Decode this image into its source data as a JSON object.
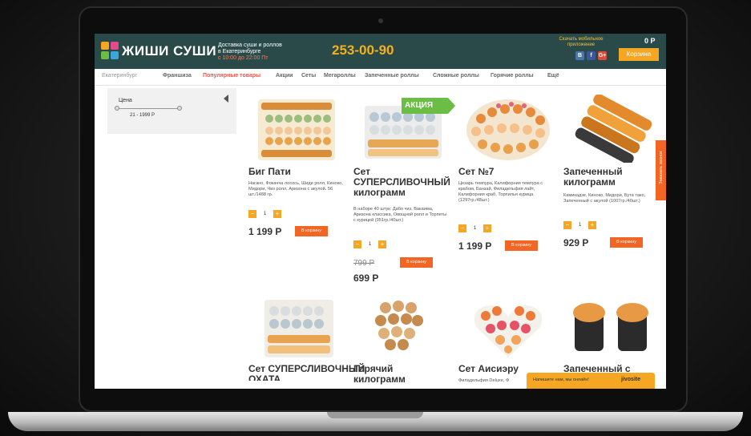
{
  "header": {
    "brand": "ЖИШИ СУШИ",
    "delivery_line1": "Доставка суши и роллов",
    "delivery_line2": "в Екатеринбурге",
    "delivery_hours": "с 10:00 до 22:00 Пт",
    "phone": "253-00-90",
    "app_text": "Скачать мобильное приложение",
    "cart_sum": "0 Р",
    "cart_button": "Корзина",
    "social": [
      "В",
      "f",
      "G+"
    ],
    "colors": {
      "header_bg": "#2a4a4a",
      "accent": "#f5a623",
      "buy": "#f26522",
      "promo": "#6bbd45"
    }
  },
  "nav": {
    "city": "Екатеринбург",
    "items": [
      "Франшиза",
      "Популярные товары",
      "Акции",
      "Сеты",
      "Мегароллы",
      "Запеченные роллы",
      "Сложные роллы",
      "Горячие роллы",
      "Ещё"
    ],
    "active_index": 1
  },
  "sidebar": {
    "price_label": "Цена",
    "price_range": "21 - 1999 Р"
  },
  "promo_tag": "АКЦИЯ",
  "products": [
    {
      "name": "Биг Пати",
      "desc": "Нагано, Фокачча лосось, Шиди ролл, Киноко, Мидори, Чиз ролл, Аризона с акулой. 56 шт./1488 гр.",
      "qty": "1",
      "price": "1 199 Р",
      "buy": "В корзину"
    },
    {
      "name": "Сет СУПЕРСЛИВОЧНЫЙ килограмм",
      "desc": "В наборе 40 штук: Дабл чиз, Вакаима, Аризона классика, Овощной ролл и Торпеты с курицей (951гр./40шт.)",
      "qty": "1",
      "old_price": "799 Р",
      "price": "699 Р",
      "buy": "В корзину"
    },
    {
      "name": "Сет №7",
      "desc": "Цезарь темпура, Калифорния темпура с крабом, Банзай, Филадельфия лайт, Калифорния краб, Торпилья курица (1297гр./48шт.)",
      "qty": "1",
      "price": "1 199 Р",
      "buy": "В корзину"
    },
    {
      "name": "Запеченный килограмм",
      "desc": "Камикадзе, Киноко, Мидори, Бута тако, Запеченный с акулой (1007гр./40шт.)",
      "qty": "1",
      "price": "929 Р",
      "buy": "В корзину"
    },
    {
      "name": "Сет СУПЕРСЛИВОЧНЫЙ",
      "name2": "ОХАТА",
      "desc": ""
    },
    {
      "name": "Горячий килограмм",
      "desc": ""
    },
    {
      "name": "Сет Аисиэру",
      "desc": "Филадельфия Deluxe, Ф"
    },
    {
      "name": "Запеченный с",
      "desc": ""
    }
  ],
  "callback": "Заказать звонок",
  "chat": {
    "text": "Напишите нам, мы онлайн!",
    "brand": "jivosite"
  }
}
